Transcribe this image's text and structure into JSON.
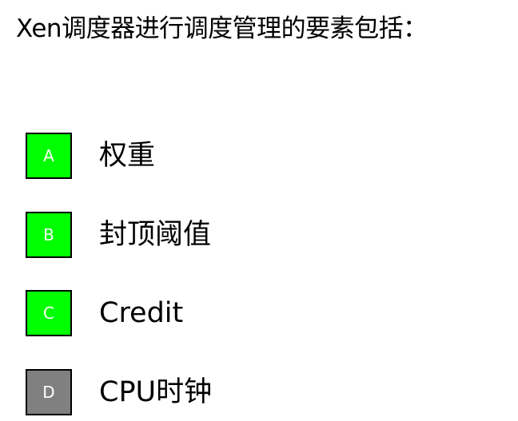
{
  "question": {
    "text": "Xen调度器进行调度管理的要素包括："
  },
  "options": [
    {
      "key": "A",
      "text": "权重",
      "color": "#00ff00",
      "state": "selected"
    },
    {
      "key": "B",
      "text": "封顶阈值",
      "color": "#00ff00",
      "state": "selected"
    },
    {
      "key": "C",
      "text": "Credit",
      "color": "#00ff00",
      "state": "selected"
    },
    {
      "key": "D",
      "text": "CPU时钟",
      "color": "#808080",
      "state": "unselected"
    }
  ]
}
